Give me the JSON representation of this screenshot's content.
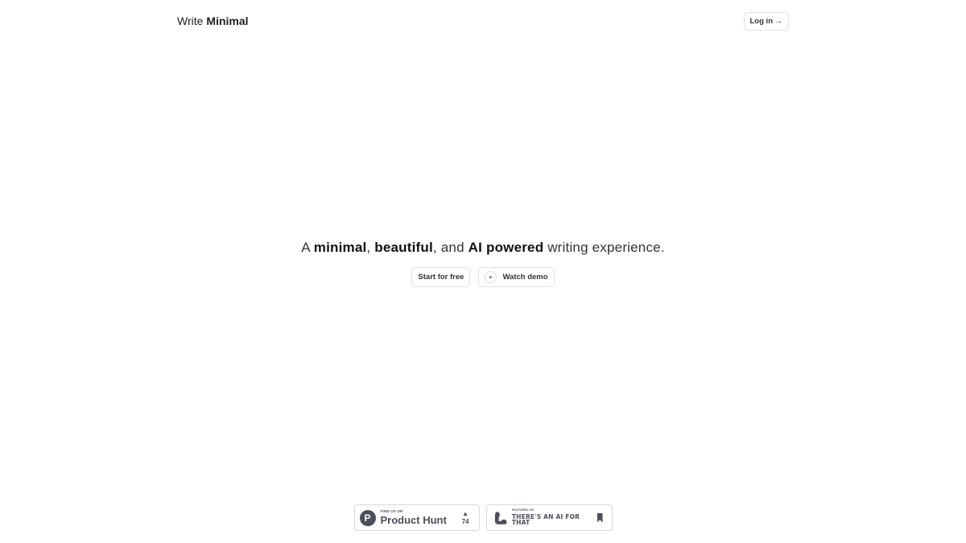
{
  "header": {
    "brand_light": "Write",
    "brand_bold": "Minimal",
    "login_label": "Log in",
    "login_arrow": "→"
  },
  "hero": {
    "tagline": {
      "p1": "A ",
      "b1": "minimal",
      "p2": ", ",
      "b2": "beautiful",
      "p3": ", and ",
      "b3": "AI powered",
      "p4": " writing experience."
    },
    "start_label": "Start for free",
    "demo_label": "Watch demo",
    "play_glyph": "▶"
  },
  "badges": {
    "product_hunt": {
      "logo_letter": "P",
      "small": "FIND US ON",
      "big": "Product Hunt",
      "vote_glyph": "▲",
      "votes": "74"
    },
    "ai_for_that": {
      "small": "FEATURED ON",
      "big": "THERE'S AN AI FOR THAT",
      "icon": "flexed-arm-icon"
    }
  },
  "colors": {
    "badge_gray": "#4b4f5c",
    "border": "#e2e2e2"
  }
}
